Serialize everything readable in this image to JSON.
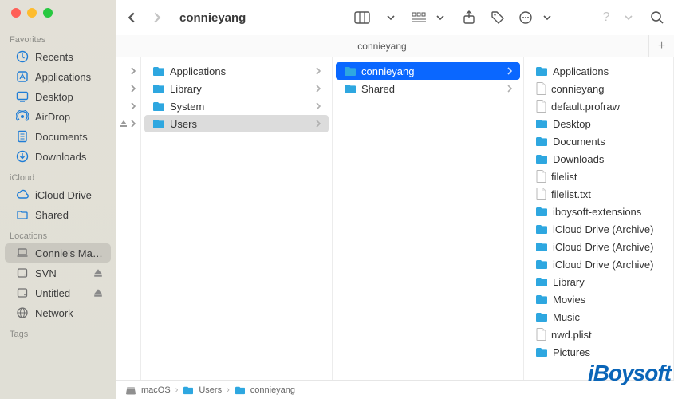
{
  "window": {
    "title": "connieyang"
  },
  "sidebar": {
    "sections": [
      {
        "label": "Favorites",
        "items": [
          {
            "label": "Recents",
            "icon": "clock"
          },
          {
            "label": "Applications",
            "icon": "app"
          },
          {
            "label": "Desktop",
            "icon": "desktop"
          },
          {
            "label": "AirDrop",
            "icon": "airdrop"
          },
          {
            "label": "Documents",
            "icon": "doc"
          },
          {
            "label": "Downloads",
            "icon": "download"
          }
        ]
      },
      {
        "label": "iCloud",
        "items": [
          {
            "label": "iCloud Drive",
            "icon": "cloud"
          },
          {
            "label": "Shared",
            "icon": "sharedfolder"
          }
        ]
      },
      {
        "label": "Locations",
        "items": [
          {
            "label": "Connie's Ma…",
            "icon": "laptop",
            "selected": true
          },
          {
            "label": "SVN",
            "icon": "disk",
            "eject": true
          },
          {
            "label": "Untitled",
            "icon": "disk",
            "eject": true
          },
          {
            "label": "Network",
            "icon": "globe"
          }
        ]
      },
      {
        "label": "Tags",
        "items": []
      }
    ]
  },
  "tabs": {
    "active": "connieyang"
  },
  "columns": [
    {
      "deviceSlots": [
        {
          "chev": true
        },
        {
          "chev": true
        },
        {
          "chev": true
        },
        {
          "ej": true,
          "chev": true
        }
      ]
    },
    {
      "items": [
        {
          "label": "Applications",
          "type": "folder",
          "chev": true
        },
        {
          "label": "Library",
          "type": "folder",
          "chev": true
        },
        {
          "label": "System",
          "type": "folder",
          "chev": true
        },
        {
          "label": "Users",
          "type": "folder",
          "chev": true,
          "sel": "grey"
        }
      ]
    },
    {
      "items": [
        {
          "label": "connieyang",
          "type": "folder",
          "chev": true,
          "sel": "blue"
        },
        {
          "label": "Shared",
          "type": "folder",
          "chev": true
        }
      ]
    },
    {
      "items": [
        {
          "label": "Applications",
          "type": "folder"
        },
        {
          "label": "connieyang",
          "type": "file"
        },
        {
          "label": "default.profraw",
          "type": "file"
        },
        {
          "label": "Desktop",
          "type": "folder"
        },
        {
          "label": "Documents",
          "type": "folder"
        },
        {
          "label": "Downloads",
          "type": "folder"
        },
        {
          "label": "filelist",
          "type": "file"
        },
        {
          "label": "filelist.txt",
          "type": "file"
        },
        {
          "label": "iboysoft-extensions",
          "type": "folder"
        },
        {
          "label": "iCloud Drive (Archive)",
          "type": "folder"
        },
        {
          "label": "iCloud Drive (Archive)",
          "type": "folder"
        },
        {
          "label": "iCloud Drive (Archive)",
          "type": "folder"
        },
        {
          "label": "Library",
          "type": "folder"
        },
        {
          "label": "Movies",
          "type": "folder"
        },
        {
          "label": "Music",
          "type": "folder"
        },
        {
          "label": "nwd.plist",
          "type": "file"
        },
        {
          "label": "Pictures",
          "type": "folder"
        }
      ]
    }
  ],
  "pathbar": [
    {
      "label": "macOS",
      "icon": "disk"
    },
    {
      "label": "Users",
      "icon": "folder"
    },
    {
      "label": "connieyang",
      "icon": "folder"
    }
  ],
  "watermark": "iBoysoft"
}
